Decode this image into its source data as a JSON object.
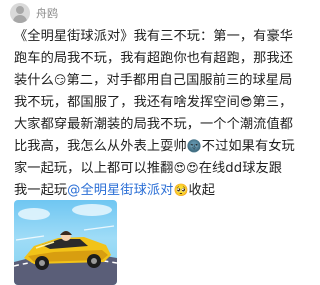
{
  "header": {
    "username": "舟鸥"
  },
  "post": {
    "lines": [
      [
        "《全明星街球派对》我有三不玩：第一，有豪华"
      ],
      [
        "跑车的局我不玩，我有超跑你也有超跑，那我还"
      ],
      [
        "装什么",
        "😏",
        "第二，对手都用自己国服前三的球星局"
      ],
      [
        "我不玩，都国服了，我还有啥发挥空间",
        "😎",
        "第三，"
      ],
      [
        "大家都穿最新潮装的局我不玩，一个个潮流值都"
      ],
      [
        "比我高，我怎么从外表上耍帅",
        "🌚",
        "不过如果有女玩"
      ],
      [
        "家一起玩，以上都可以推翻",
        "😍😍",
        "在线dd球友跟"
      ],
      [
        "我一起玩",
        "@全明星街球派对",
        "🥺",
        "收起"
      ]
    ]
  },
  "image": {
    "alt": "超跑赛车游戏截图"
  }
}
